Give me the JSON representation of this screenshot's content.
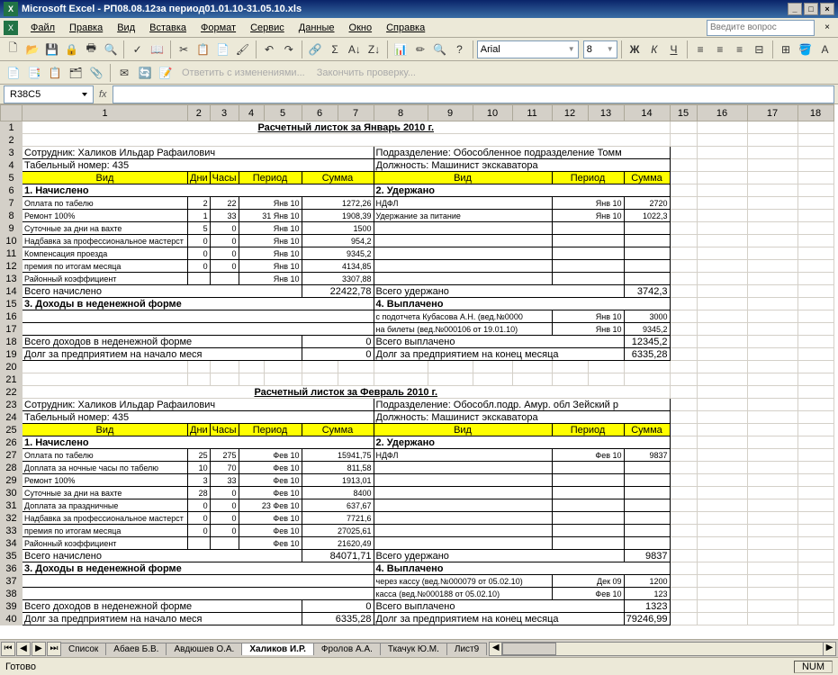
{
  "title": "Microsoft Excel - РП08.08.12за период01.01.10-31.05.10.xls",
  "menu": [
    "Файл",
    "Правка",
    "Вид",
    "Вставка",
    "Формат",
    "Сервис",
    "Данные",
    "Окно",
    "Справка"
  ],
  "askPlaceholder": "Введите вопрос",
  "font": {
    "name": "Arial",
    "size": "8"
  },
  "toolbar2": {
    "reply": "Ответить с изменениями...",
    "finish": "Закончить проверку..."
  },
  "namebox": "R38C5",
  "cols": [
    "",
    "1",
    "2",
    "3",
    "4",
    "5",
    "6",
    "7",
    "8",
    "9",
    "10",
    "11",
    "12",
    "13",
    "14",
    "15",
    "16",
    "17",
    "18"
  ],
  "sec1": {
    "title": "Расчетный листок за Январь 2010 г.",
    "emp": "Сотрудник: Халиков Ильдар Рафаилович",
    "tab": "Табельный номер: 435",
    "podr": "Подразделение: Обособленное подразделение Томм",
    "dolz": "Должность: Машинист экскаватора",
    "hdr": [
      "Вид",
      "Дни",
      "Часы",
      "Период",
      "Сумма",
      "Вид",
      "Период",
      "Сумма"
    ],
    "nach": "1. Начислено",
    "uder": "2. Удержано",
    "rows": [
      {
        "v": "Оплата по табелю",
        "d": "2",
        "h": "22",
        "p": "Янв 10",
        "s": "1272,26",
        "v2": "НДФЛ",
        "p2": "Янв 10",
        "s2": "2720"
      },
      {
        "v": "Ремонт 100%",
        "d": "1",
        "h": "33",
        "p": "31 Янв 10",
        "s": "1908,39",
        "v2": "Удержание за питание",
        "p2": "Янв 10",
        "s2": "1022,3"
      },
      {
        "v": "Суточные за дни на вахте",
        "d": "5",
        "h": "0",
        "p": "Янв 10",
        "s": "1500",
        "v2": "",
        "p2": "",
        "s2": ""
      },
      {
        "v": "Надбавка за профессиональное мастерст",
        "d": "0",
        "h": "0",
        "p": "Янв 10",
        "s": "954,2",
        "v2": "",
        "p2": "",
        "s2": ""
      },
      {
        "v": "Компенсация проезда",
        "d": "0",
        "h": "0",
        "p": "Янв 10",
        "s": "9345,2",
        "v2": "",
        "p2": "",
        "s2": ""
      },
      {
        "v": "премия по итогам месяца",
        "d": "0",
        "h": "0",
        "p": "Янв 10",
        "s": "4134,85",
        "v2": "",
        "p2": "",
        "s2": ""
      },
      {
        "v": "Районный коэффициент",
        "d": "",
        "h": "",
        "p": "Янв 10",
        "s": "3307,88",
        "v2": "",
        "p2": "",
        "s2": ""
      }
    ],
    "totNach": "Всего начислено",
    "totNachV": "22422,78",
    "totUder": "Всего удержано",
    "totUderV": "3742,3",
    "doh": "3. Доходы в неденежной форме",
    "vyp": "4. Выплачено",
    "vypRows": [
      {
        "v": "с подотчета Кубасова А.Н. (вед.№0000",
        "p": "Янв 10",
        "s": "3000"
      },
      {
        "v": "на билеты (вед.№000106 от 19.01.10)",
        "p": "Янв 10",
        "s": "9345,2"
      }
    ],
    "totDoh": "Всего доходов в неденежной форме",
    "totDohV": "0",
    "totVyp": "Всего выплачено",
    "totVypV": "12345,2",
    "dolg1": "Долг за предприятием на начало меся",
    "dolg1V": "0",
    "dolg2": "Долг за предприятием  на конец месяца",
    "dolg2V": "6335,28"
  },
  "sec2": {
    "title": "Расчетный листок за Февраль 2010 г.",
    "emp": "Сотрудник: Халиков Ильдар Рафаилович",
    "tab": "Табельный номер: 435",
    "podr": "Подразделение: Обособл.подр. Амур. обл Зейский р",
    "dolz": "Должность: Машинист экскаватора",
    "nach": "1. Начислено",
    "uder": "2. Удержано",
    "rows": [
      {
        "v": "Оплата по табелю",
        "d": "25",
        "h": "275",
        "p": "Фев 10",
        "s": "15941,75",
        "v2": "НДФЛ",
        "p2": "Фев 10",
        "s2": "9837"
      },
      {
        "v": "Доплата за ночные часы по табелю",
        "d": "10",
        "h": "70",
        "p": "Фев 10",
        "s": "811,58",
        "v2": "",
        "p2": "",
        "s2": ""
      },
      {
        "v": "Ремонт 100%",
        "d": "3",
        "h": "33",
        "p": "Фев 10",
        "s": "1913,01",
        "v2": "",
        "p2": "",
        "s2": ""
      },
      {
        "v": "Суточные за дни на вахте",
        "d": "28",
        "h": "0",
        "p": "Фев 10",
        "s": "8400",
        "v2": "",
        "p2": "",
        "s2": ""
      },
      {
        "v": "Доплата за праздничные",
        "d": "0",
        "h": "0",
        "p": "23 Фев 10",
        "s": "637,67",
        "v2": "",
        "p2": "",
        "s2": ""
      },
      {
        "v": "Надбавка за профессиональное мастерст",
        "d": "0",
        "h": "0",
        "p": "Фев 10",
        "s": "7721,6",
        "v2": "",
        "p2": "",
        "s2": ""
      },
      {
        "v": "премия по итогам месяца",
        "d": "0",
        "h": "0",
        "p": "Фев 10",
        "s": "27025,61",
        "v2": "",
        "p2": "",
        "s2": ""
      },
      {
        "v": "Районный коэффициент",
        "d": "",
        "h": "",
        "p": "Фев 10",
        "s": "21620,49",
        "v2": "",
        "p2": "",
        "s2": ""
      }
    ],
    "totNach": "Всего начислено",
    "totNachV": "84071,71",
    "totUder": "Всего удержано",
    "totUderV": "9837",
    "doh": "3. Доходы в неденежной форме",
    "vyp": "4. Выплачено",
    "vypRows": [
      {
        "v": "через кассу (вед.№000079 от 05.02.10)",
        "p": "Дек 09",
        "s": "1200"
      },
      {
        "v": "касса (вед.№000188 от 05.02.10)",
        "p": "Фев 10",
        "s": "123"
      }
    ],
    "totDoh": "Всего доходов в неденежной форме",
    "totDohV": "0",
    "totVyp": "Всего выплачено",
    "totVypV": "1323",
    "dolg1": "Долг за предприятием на начало меся",
    "dolg1V": "6335,28",
    "dolg2": "Долг за предприятием  на конец месяца",
    "dolg2V": "79246,99"
  },
  "tabs": [
    "Список",
    "Абаев Б.В.",
    "Авдюшев О.А.",
    "Халиков И.Р.",
    "Фролов А.А.",
    "Ткачук Ю.М.",
    "Лист9"
  ],
  "activeTab": 3,
  "status": "Готово",
  "num": "NUM"
}
